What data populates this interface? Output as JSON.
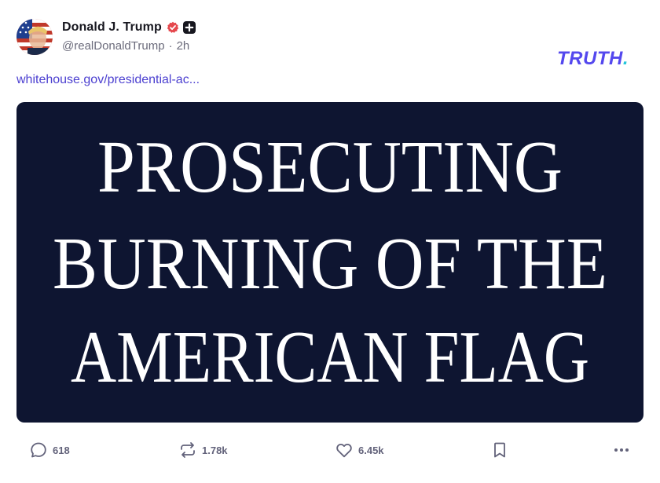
{
  "post": {
    "author": {
      "display_name": "Donald J. Trump",
      "handle": "@realDonaldTrump",
      "separator": "·",
      "time": "2h",
      "verified_icon": "verified-check-icon",
      "verified_color": "#e5484d",
      "badge_icon": "plus-badge-icon"
    },
    "brand": {
      "logo_text": "TRUTH.",
      "logo_color": "#5448ee",
      "dot_color": "#26c6da"
    },
    "link_text": "whitehouse.gov/presidential-ac...",
    "image": {
      "background_color": "#0e1531",
      "text_color": "#ffffff",
      "lines": [
        "PROSECUTING",
        "BURNING OF THE",
        "AMERICAN FLAG"
      ]
    },
    "actions": {
      "reply": {
        "icon": "reply-bubble-icon",
        "count": "618"
      },
      "retruth": {
        "icon": "retruth-icon",
        "count": "1.78k"
      },
      "like": {
        "icon": "heart-icon",
        "count": "6.45k"
      },
      "bookmark": {
        "icon": "bookmark-icon"
      },
      "more": {
        "icon": "more-dots-icon"
      }
    }
  }
}
